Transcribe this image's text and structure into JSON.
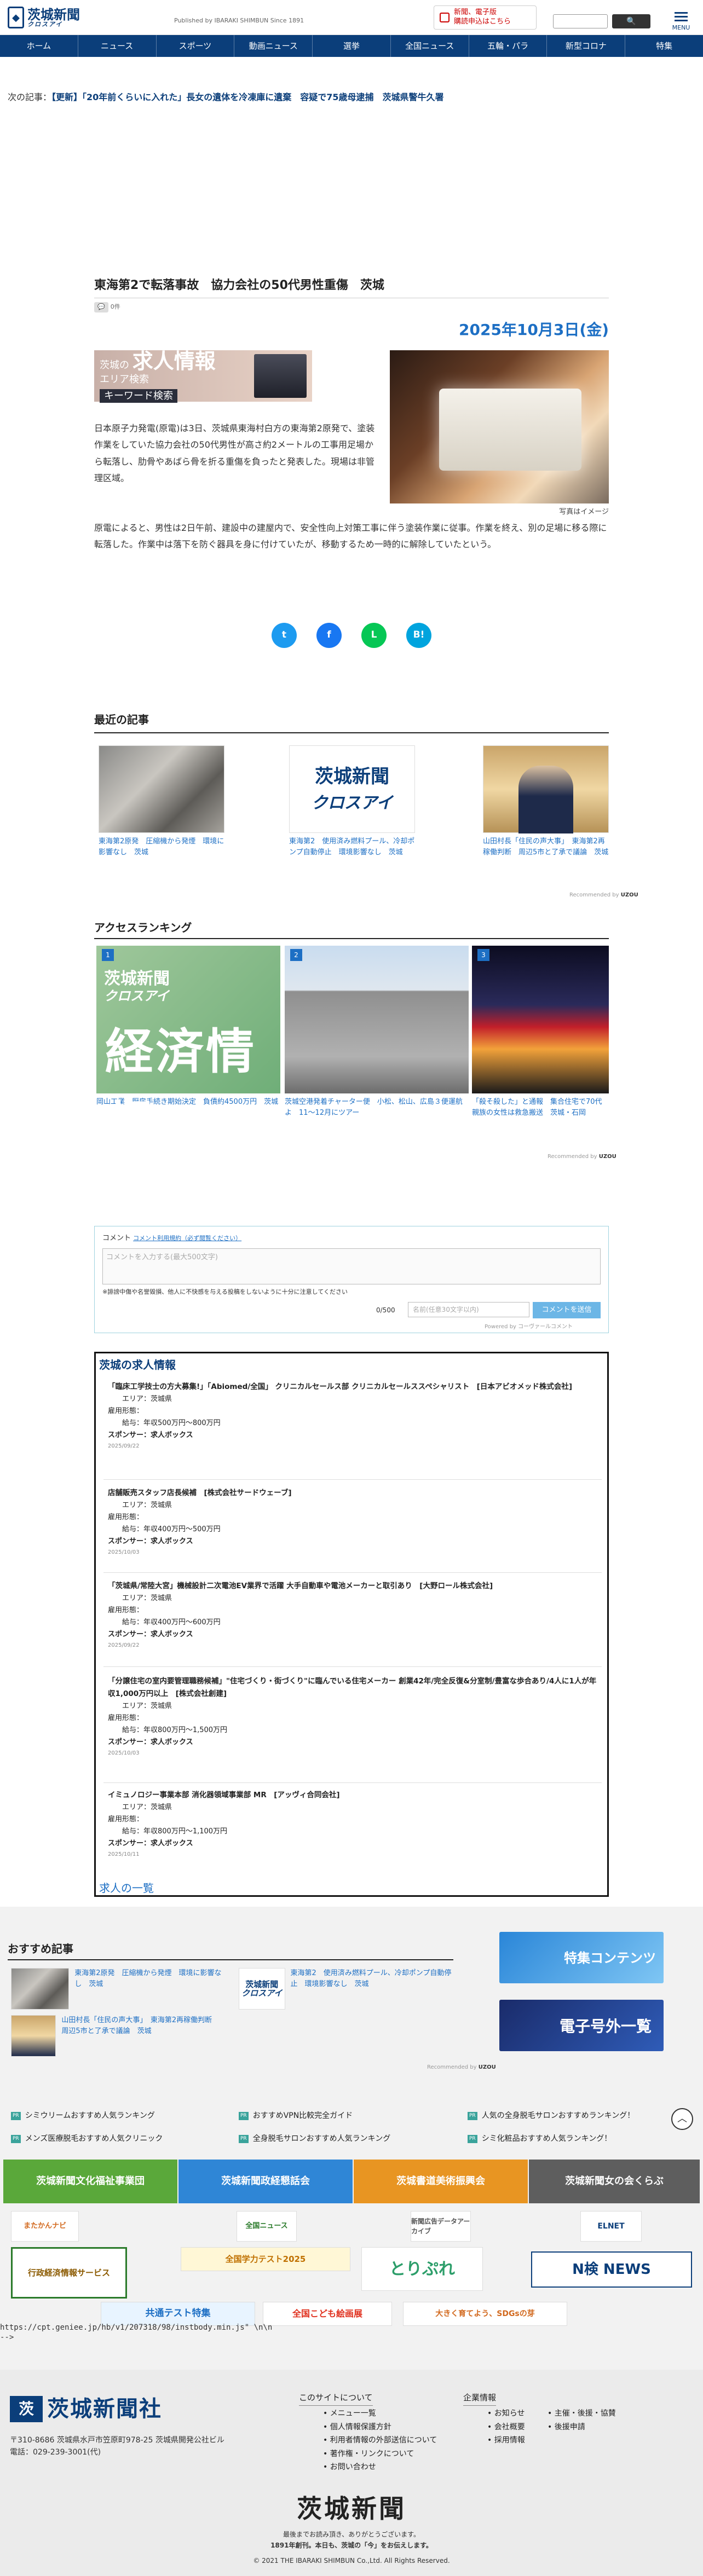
{
  "header": {
    "logo_text": "茨城新聞",
    "logo_sub": "クロスアイ",
    "published": "Published by IBARAKI SHIMBUN Since 1891",
    "subscribe_line1": "新聞、電子版",
    "subscribe_line2": "購読申込はこちら",
    "search_button": "🔍",
    "menu_label": "MENU"
  },
  "nav": [
    "ホーム",
    "ニュース",
    "スポーツ",
    "動画ニュース",
    "選挙",
    "全国ニュース",
    "五輪・パラ",
    "新型コロナ",
    "特集"
  ],
  "next_article": {
    "prefix": "次の記事：",
    "link": "【更新】「20年前くらいに入れた」長女の遺体を冷凍庫に遺棄　容疑で75歳母逮捕　茨城県警牛久署"
  },
  "article": {
    "title": "東海第2で転落事故　協力会社の50代男性重傷　茨城",
    "meta": "0件",
    "date": "2025年10月3日(金)",
    "para1": "日本原子力発電(原電)は3日、茨城県東海村白方の東海第2原発で、塗装作業をしていた協力会社の50代男性が高さ約2メートルの工事用足場から転落し、肋骨やあばら骨を折る重傷を負ったと発表した。現場は非管理区域。",
    "para2": "原電によると、男性は2日午前、建設中の建屋内で、安全性向上対策工事に伴う塗装作業に従事。作業を終え、別の足場に移る際に転落した。作業中は落下を防ぐ器具を身に付けていたが、移動するため一時的に解除していたという。",
    "photo_caption": "写真はイメージ"
  },
  "ad": {
    "line1": "茨城の",
    "emph": "求人情報",
    "line2": "エリア検索",
    "keyword": "キーワード検索"
  },
  "share": [
    "t",
    "f",
    "L",
    "B!"
  ],
  "recent": {
    "heading": "最近の記事",
    "items": [
      "東海第2原発　圧縮機から発煙　環境に影響なし　茨城",
      "東海第2　使用済み燃料プール、冷却ポンプ自動停止　環境影響なし　茨城",
      "山田村長「住民の声大事」　東海第2再稼働判断　周辺5市と了承で議論　茨城"
    ],
    "powered": "Recommended by"
  },
  "ranking": {
    "heading": "アクセスランキング",
    "items": [
      {
        "rank": "1",
        "caption": "岡山工業　厨房手続き期始決定　負債約4500万円　茨城",
        "overlay": "経済情報"
      },
      {
        "rank": "2",
        "caption": "茨城空港発着チャーター便　小松、松山、広島３便運航よ　11〜12月にツアー"
      },
      {
        "rank": "3",
        "caption": "「殺そ殺した」と通報　集合住宅で70代親族の女性は救急搬送　茨城・石岡"
      }
    ],
    "powered": "Recommended by"
  },
  "comment": {
    "label": "コメント",
    "note": "コメント利用規約（必ず閲覧ください）",
    "placeholder": "コメントを入力する(最大500文字)",
    "warning": "※誹謗中傷や名誉毀損、他人に不快感を与える投稿をしないように十分に注意してください",
    "count": "0/500",
    "nick_placeholder": "名前(任意30文字以内)",
    "post_button": "コメントを送信",
    "powered": "Powered by コーヴァールコメント"
  },
  "jobs": {
    "heading": "茨城の求人情報",
    "items": [
      {
        "title": "「臨床工学技士の方大募集!」「Abiomed/全国」 クリニカルセールス部 クリニカルセールススペシャリスト　[日本アビオメッド株式会社]",
        "area": "エリア：茨城県",
        "type": "雇用形態：",
        "salary": "給与：年収500万円〜800万円",
        "sponsor": "スポンサー：求人ボックス",
        "date": "2025/09/22"
      },
      {
        "title": "店舗販売スタッフ店長候補　[株式会社サードウェーブ]",
        "area": "エリア：茨城県",
        "type": "雇用形態：",
        "salary": "給与：年収400万円〜500万円",
        "sponsor": "スポンサー：求人ボックス",
        "date": "2025/10/03"
      },
      {
        "title": "「茨城県/常陸大宮」機械設計二次電池EV業界で活躍 大手自動車や電池メーカーと取引あり　[大野ロール株式会社]",
        "area": "エリア：茨城県",
        "type": "雇用形態：",
        "salary": "給与：年収400万円〜600万円",
        "sponsor": "スポンサー：求人ボックス",
        "date": "2025/09/22"
      },
      {
        "title": "「分譲住宅の室内要管理職務候補」\"住宅づくり・街づくり\"に臨んでいる住宅メーカー 創業42年/完全反復&分室制/豊富な歩合あり/4人に1人が年収1,000万円以上　[株式会社創建]",
        "area": "エリア：茨城県",
        "type": "雇用形態：",
        "salary": "給与：年収800万円〜1,500万円",
        "sponsor": "スポンサー：求人ボックス",
        "date": "2025/10/03"
      },
      {
        "title": "イミュノロジー事業本部 消化器領域事業部 MR　[アッヴィ合同会社]",
        "area": "エリア：茨城県",
        "type": "雇用形態：",
        "salary": "給与：年収800万円〜1,100万円",
        "sponsor": "スポンサー：求人ボックス",
        "date": "2025/10/11"
      }
    ],
    "list_link": "求人の一覧"
  },
  "recommend2": {
    "heading": "おすすめ記事",
    "items": [
      "東海第2原発　圧縮機から発煙　環境に影響なし　茨城",
      "東海第2　使用済み燃料プール、冷却ポンプ自動停止　環境影響なし　茨城",
      "山田村長「住民の声大事」　東海第2再稼働判断　周辺5市と了承で議論　茨城"
    ],
    "powered": "Recommended by"
  },
  "side_banners": [
    "特集コンテンツ",
    "電子号外一覧"
  ],
  "pr_links": [
    "シミウリームおすすめ人気ランキング",
    "おすすめVPN比較完全ガイド",
    "人気の全身脱毛サロンおすすめランキング！",
    "メンズ医療脱毛おすすめ人気クリニック",
    "全身脱毛サロンおすすめ人気ランキング",
    "シミ化粧品おすすめ人気ランキング！"
  ],
  "pr_tag": "PR",
  "top_button": "︿",
  "org_buttons": [
    "茨城新聞文化福祉事業団",
    "茨城新聞政経懇話会",
    "茨城書道美術振興会",
    "茨城新聞女の会くらぶ"
  ],
  "partners": [
    "またかんナビ",
    "全国ニュース",
    "新聞広告データアーカイブ",
    "ELNET",
    "行政経済情報サービス",
    "全国学力テスト2025",
    "とりぷれ",
    "N検 NEWS",
    "共通テスト特集",
    "全国こども絵画展",
    "大きく育てよう、SDGsの芽"
  ],
  "genieee": "https://cpt.geniee.jp/hb/v1/207318/98/instbody.min.js\" \\n\\n\n-->",
  "footer": {
    "mark": "茨",
    "name": "茨城新聞社",
    "address1": "〒310-8686 茨城県水戸市笠原町978-25 茨城県開発公社ビル",
    "phone": "電話：029-239-3001(代)",
    "col1_heading": "このサイトについて",
    "col1": [
      "メニュー一覧",
      "個人情報保護方針",
      "利用者情報の外部送信について",
      "著作権・リンクについて",
      "お問い合わせ"
    ],
    "col2_heading": "企業情報",
    "col2a": [
      "お知らせ",
      "会社概要",
      "採用情報"
    ],
    "col2b": [
      "主催・後援・協賛",
      "後援申請"
    ],
    "brand": "茨城新聞",
    "tag1": "最後までお読み頂き、ありがとうございます。",
    "tag2": "1891年創刊。本日も、茨城の「今」をお伝えします。",
    "copyright": "© 2021 THE IBARAKI SHIMBUN Co.,Ltd. All Rights Reserved."
  },
  "colors": {
    "brand": "#0b3e7a",
    "accent": "#1d6fc4",
    "twitter": "#1d9bf0",
    "facebook": "#1877f2",
    "line": "#06c755",
    "hatena": "#00a4de"
  }
}
